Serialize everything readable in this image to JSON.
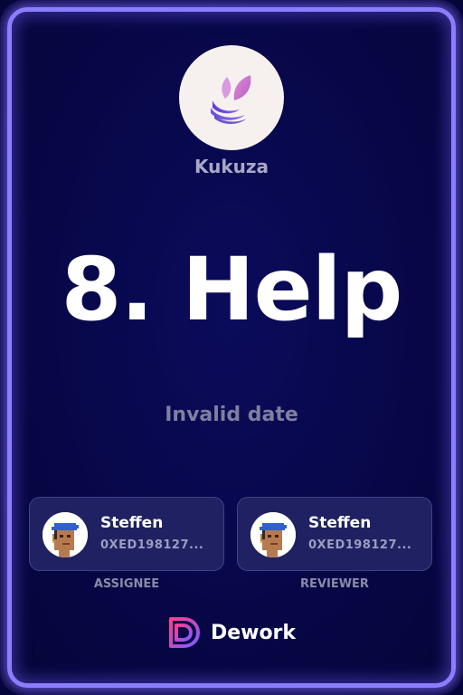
{
  "organization": {
    "name": "Kukuza",
    "logo_icon": "leaf-wave-icon"
  },
  "task": {
    "title": "8. Help",
    "date_text": "Invalid date"
  },
  "assignee": {
    "name": "Steffen",
    "address": "0XED198127...",
    "role_label": "ASSIGNEE",
    "avatar_icon": "pixel-avatar-icon"
  },
  "reviewer": {
    "name": "Steffen",
    "address": "0XED198127...",
    "role_label": "REVIEWER",
    "avatar_icon": "pixel-avatar-icon"
  },
  "brand": {
    "name": "Dework",
    "logo_icon": "dework-logo-icon"
  },
  "colors": {
    "background": "#070748",
    "glow_border": "#8b7dff",
    "card_background": "#1f2162",
    "title_text": "#ffffff",
    "muted_text": "#7f7f9f",
    "brand_gradient_start": "#ff3d8b",
    "brand_gradient_end": "#7b5cff"
  }
}
